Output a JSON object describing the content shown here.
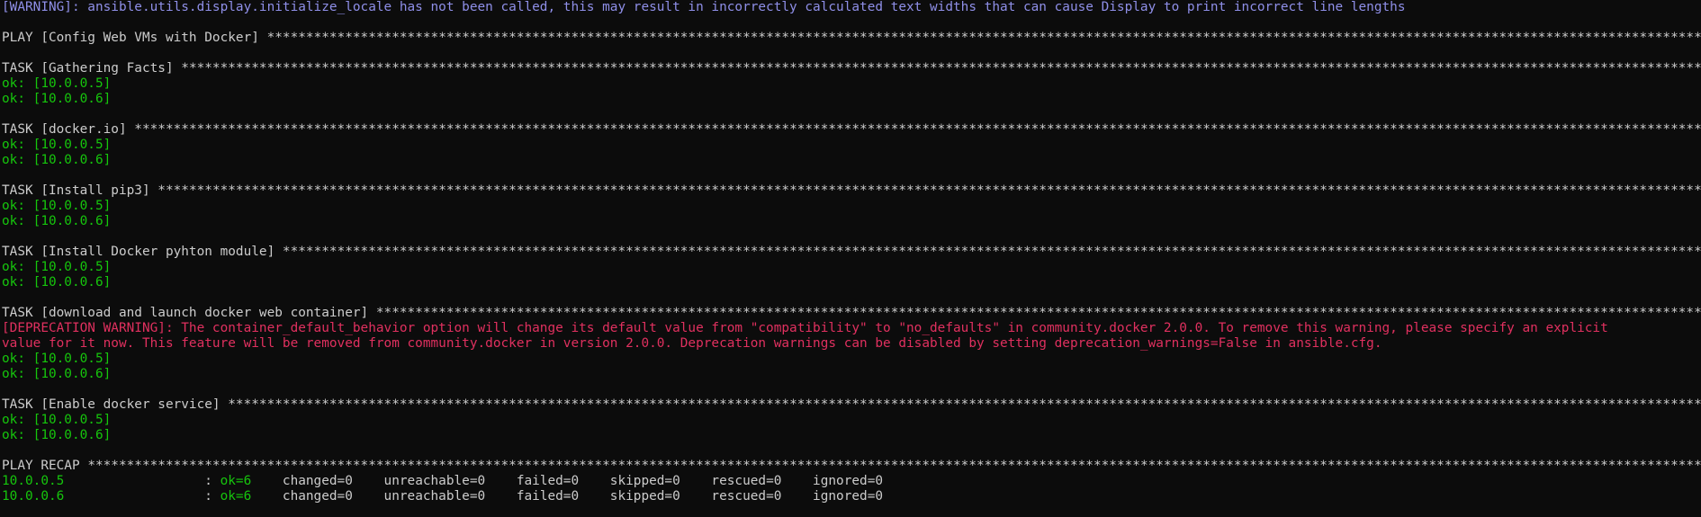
{
  "terminal": {
    "warning_line": "[WARNING]: ansible.utils.display.initialize_locale has not been called, this may result in incorrectly calculated text widths that can cause Display to print incorrect line lengths",
    "play_header": "PLAY [Config Web VMs with Docker]",
    "tasks": [
      {
        "header": "TASK [Gathering Facts]",
        "results": [
          "ok: [10.0.0.5]",
          "ok: [10.0.0.6]"
        ]
      },
      {
        "header": "TASK [docker.io]",
        "results": [
          "ok: [10.0.0.5]",
          "ok: [10.0.0.6]"
        ]
      },
      {
        "header": "TASK [Install pip3]",
        "results": [
          "ok: [10.0.0.5]",
          "ok: [10.0.0.6]"
        ]
      },
      {
        "header": "TASK [Install Docker pyhton module]",
        "results": [
          "ok: [10.0.0.5]",
          "ok: [10.0.0.6]"
        ]
      },
      {
        "header": "TASK [download and launch docker web container]",
        "deprecation": [
          "[DEPRECATION WARNING]: The container_default_behavior option will change its default value from \"compatibility\" to \"no_defaults\" in community.docker 2.0.0. To remove this warning, please specify an explicit",
          "value for it now. This feature will be removed from community.docker in version 2.0.0. Deprecation warnings can be disabled by setting deprecation_warnings=False in ansible.cfg."
        ],
        "results": [
          "ok: [10.0.0.5]",
          "ok: [10.0.0.6]"
        ]
      },
      {
        "header": "TASK [Enable docker service]",
        "results": [
          "ok: [10.0.0.5]",
          "ok: [10.0.0.6]"
        ]
      }
    ],
    "recap_header": "PLAY RECAP",
    "recap": [
      {
        "host": "10.0.0.5",
        "sep": ": ",
        "ok": "ok=6",
        "rest": "    changed=0    unreachable=0    failed=0    skipped=0    rescued=0    ignored=0"
      },
      {
        "host": "10.0.0.6",
        "sep": ": ",
        "ok": "ok=6",
        "rest": "    changed=0    unreachable=0    failed=0    skipped=0    rescued=0    ignored=0"
      }
    ],
    "colors": {
      "background": "#0c0c0c",
      "text": "#cccccc",
      "ok": "#16c60c",
      "warning": "#8f8fe8",
      "deprecation": "#e0305f"
    }
  }
}
